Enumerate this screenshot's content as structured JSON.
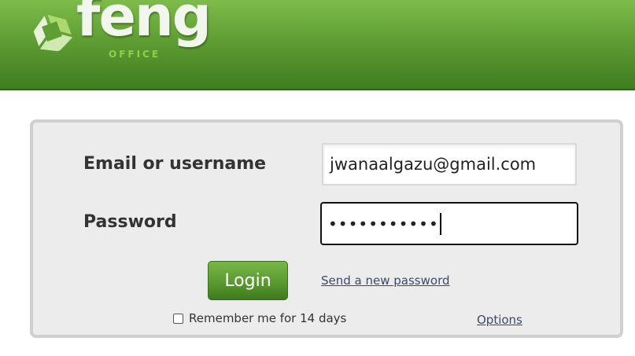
{
  "header": {
    "logo_word": "feng",
    "logo_sub": "OFFICE",
    "colors": {
      "top": "#7dbb4a",
      "bottom": "#3f7d22",
      "accent": "#8fcf4a"
    }
  },
  "login_form": {
    "email_label": "Email or username",
    "email_value": "jwanaalgazu@gmail.com",
    "password_label": "Password",
    "password_masked": "•••••••••••",
    "login_button": "Login",
    "send_password_link": "Send a new password",
    "remember_label": "Remember me for 14 days",
    "remember_checked": false,
    "options_link": "Options"
  },
  "icons": {
    "logo_mark": "feng-office-logo-icon"
  }
}
